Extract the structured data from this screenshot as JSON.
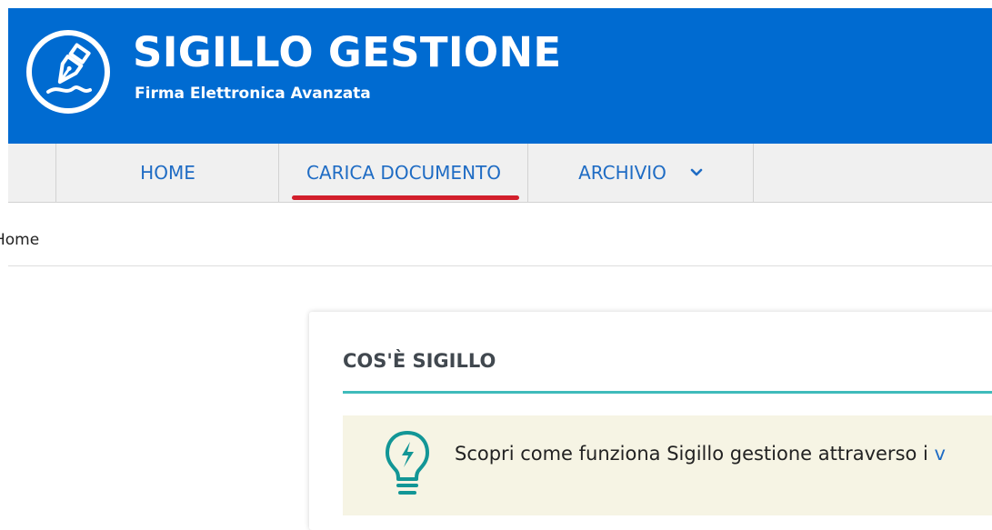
{
  "header": {
    "title": "SIGILLO GESTIONE",
    "subtitle": "Firma Elettronica Avanzata",
    "logo_icon": "fountain-pen-signature-icon",
    "background_color": "#006bd1"
  },
  "nav": {
    "items": [
      {
        "label": "HOME"
      },
      {
        "label": "CARICA DOCUMENTO",
        "active": true
      },
      {
        "label": "ARCHIVIO",
        "has_dropdown": true
      }
    ],
    "active_underline_color": "#d21f2c",
    "link_color": "#1f6cc4"
  },
  "breadcrumb": {
    "current": "Home"
  },
  "card": {
    "title": "COS'È SIGILLO",
    "accent_color": "#3fbbbb",
    "notice": {
      "icon": "lightbulb-icon",
      "text": "Scopri come funziona Sigillo gestione attraverso i ",
      "link_text": "v"
    }
  }
}
